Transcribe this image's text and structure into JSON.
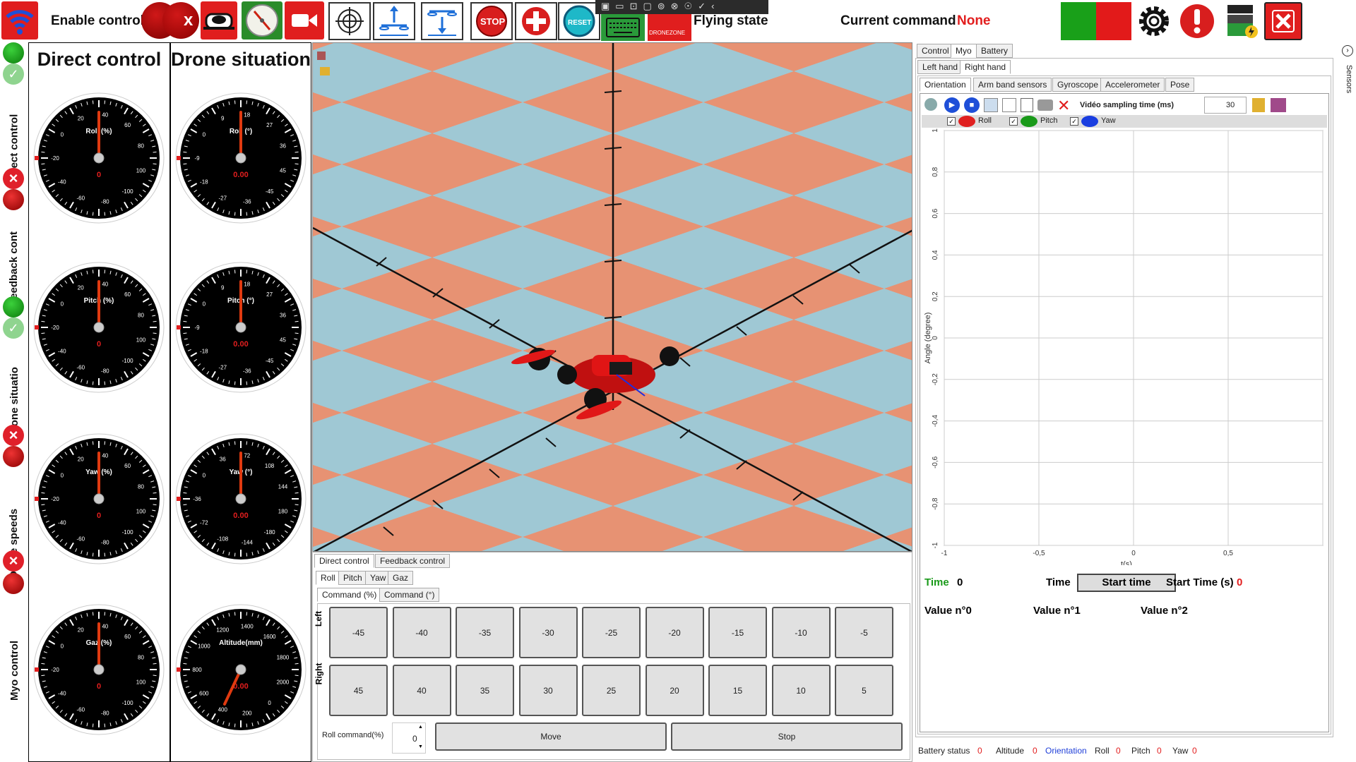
{
  "toolbar": {
    "enable_control": "Enable control",
    "flying_state": "Flying state",
    "current_command_label": "Current command",
    "current_command_value": "None",
    "stop_label": "STOP",
    "reset_label": "RESET",
    "logo_text": "DRONEZONE"
  },
  "sidebar": {
    "sections": [
      "Direct control",
      "Feedback cont",
      "Drone situatio",
      "Drone speeds",
      "Myo control"
    ]
  },
  "panels": {
    "direct_title": "Direct control",
    "drone_title": "Drone situation"
  },
  "gauges": {
    "direct": [
      {
        "label": "Roll (%)",
        "value": "0",
        "ticks": [
          "-20",
          "0",
          "20",
          "40",
          "60",
          "80",
          "100",
          "-100",
          "-80",
          "-60",
          "-40"
        ]
      },
      {
        "label": "Pitch (%)",
        "value": "0",
        "ticks": [
          "-20",
          "0",
          "20",
          "40",
          "60",
          "80",
          "100",
          "-100",
          "-80",
          "-60",
          "-40"
        ]
      },
      {
        "label": "Yaw (%)",
        "value": "0",
        "ticks": [
          "-20",
          "0",
          "20",
          "40",
          "60",
          "80",
          "100",
          "-100",
          "-80",
          "-60",
          "-40"
        ]
      },
      {
        "label": "Gaz (%)",
        "value": "0",
        "ticks": [
          "-20",
          "0",
          "20",
          "40",
          "60",
          "80",
          "100",
          "-100",
          "-80",
          "-60",
          "-40"
        ]
      }
    ],
    "drone": [
      {
        "label": "Roll (°)",
        "value": "0.00",
        "ticks": [
          "-9",
          "0",
          "9",
          "18",
          "27",
          "36",
          "45",
          "-45",
          "-36",
          "-27",
          "-18"
        ]
      },
      {
        "label": "Pitch (°)",
        "value": "0.00",
        "ticks": [
          "-9",
          "0",
          "9",
          "18",
          "27",
          "36",
          "45",
          "-45",
          "-36",
          "-27",
          "-18"
        ]
      },
      {
        "label": "Yaw (°)",
        "value": "0.00",
        "ticks": [
          "-36",
          "0",
          "36",
          "72",
          "108",
          "144",
          "180",
          "-180",
          "-144",
          "-108",
          "-72"
        ]
      },
      {
        "label": "Altitude(mm)",
        "value": "0.00",
        "ticks": [
          "800",
          "1000",
          "1200",
          "1400",
          "1600",
          "1800",
          "2000",
          "0",
          "200",
          "400",
          "600"
        ]
      }
    ]
  },
  "control": {
    "tabs_top": [
      "Direct control",
      "Feedback control"
    ],
    "tabs_axis": [
      "Roll",
      "Pitch",
      "Yaw",
      "Gaz"
    ],
    "tabs_cmd": [
      "Command (%)",
      "Command (°)"
    ],
    "left_label": "Left",
    "right_label": "Right",
    "left_values": [
      "-45",
      "-40",
      "-35",
      "-30",
      "-25",
      "-20",
      "-15",
      "-10",
      "-5"
    ],
    "right_values": [
      "45",
      "40",
      "35",
      "30",
      "25",
      "20",
      "15",
      "10",
      "5"
    ],
    "roll_command_label": "Roll command(%)",
    "roll_command_value": "0",
    "move": "Move",
    "stop": "Stop"
  },
  "myo": {
    "tabs_top": [
      "Control",
      "Myo",
      "Battery"
    ],
    "tabs_hand": [
      "Left hand",
      "Right hand"
    ],
    "tabs_sensor": [
      "Orientation",
      "Arm band sensors",
      "Gyroscope",
      "Accelerometer",
      "Pose"
    ],
    "sampling_label": "Vidéo sampling time (ms)",
    "sampling_value": "30",
    "legend": [
      "Roll",
      "Pitch",
      "Yaw"
    ],
    "sensors_label": "Sensors",
    "time_label": "Time",
    "time_value": "0",
    "time2_label": "Time",
    "start_time_button": "Start time",
    "start_time_label": "Start Time (s)",
    "start_time_value": "0",
    "value0": "Value n°0",
    "value1": "Value n°1",
    "value2": "Value n°2"
  },
  "status": {
    "battery_label": "Battery status",
    "battery_value": "0",
    "altitude_label": "Altitude",
    "altitude_value": "0",
    "orientation_label": "Orientation",
    "roll_label": "Roll",
    "roll_value": "0",
    "pitch_label": "Pitch",
    "pitch_value": "0",
    "yaw_label": "Yaw",
    "yaw_value": "0"
  },
  "chart_data": {
    "type": "line",
    "xlabel": "t(s)",
    "ylabel": "Angle (degree)",
    "xlim": [
      -1,
      1
    ],
    "ylim": [
      -1,
      1
    ],
    "xticks": [
      "-1",
      "-0,5",
      "0",
      "0,5"
    ],
    "yticks": [
      "1",
      "0,8",
      "0,6",
      "0,4",
      "0,2",
      "0",
      "-0,2",
      "-0,4",
      "-0,6",
      "-0,8",
      "-1"
    ],
    "grid": true,
    "series": [
      {
        "name": "Roll",
        "color": "#e02020",
        "values": []
      },
      {
        "name": "Pitch",
        "color": "#1a9a1a",
        "values": []
      },
      {
        "name": "Yaw",
        "color": "#1a3ee0",
        "values": []
      }
    ]
  }
}
